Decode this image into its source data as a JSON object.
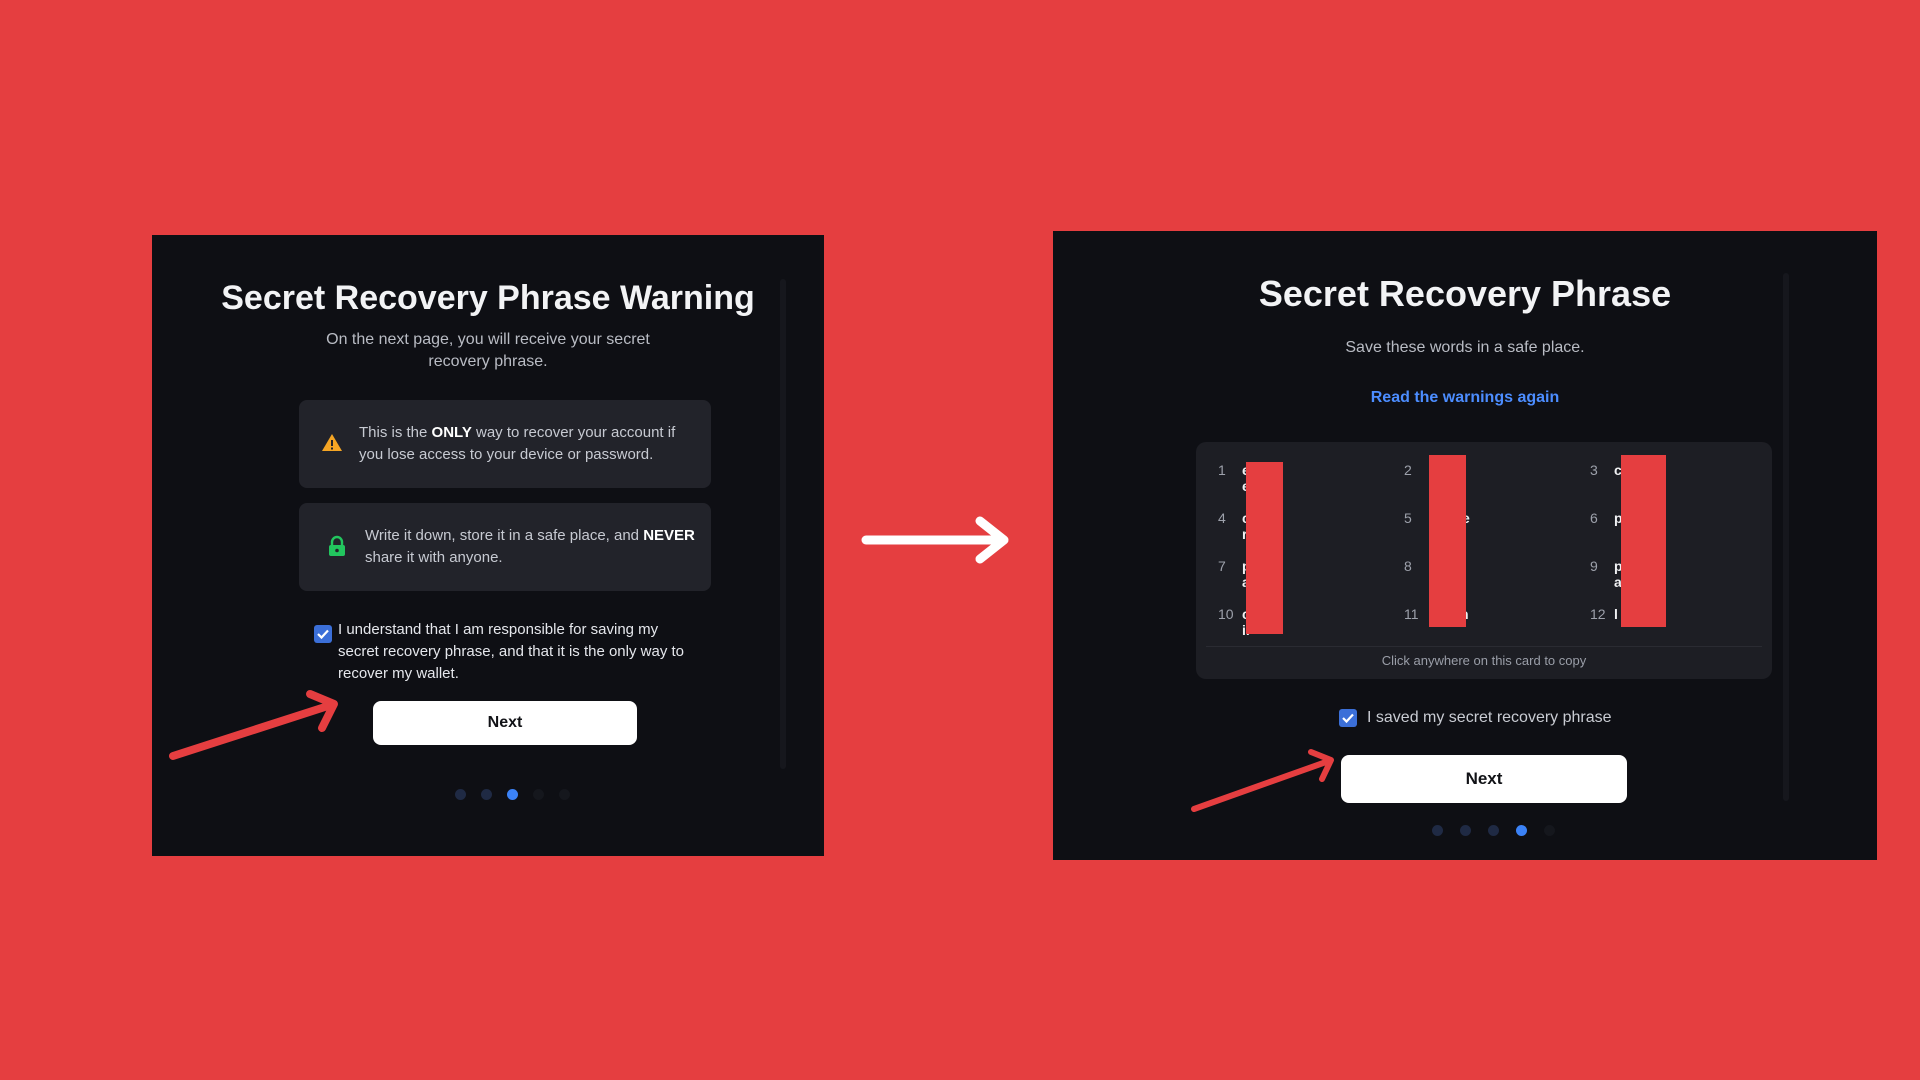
{
  "left": {
    "title": "Secret Recovery Phrase Warning",
    "subtitle": "On the next page, you will receive your secret recovery phrase.",
    "cards": [
      {
        "icon": "warning-triangle-icon",
        "text_before": "This is the ",
        "emphasis": "ONLY",
        "text_after": " way to recover your account if you lose access to your device or password."
      },
      {
        "icon": "lock-icon",
        "text_before": "Write it down, store it in a safe place, and ",
        "emphasis": "NEVER",
        "text_after": " share it with anyone."
      }
    ],
    "checkbox_label": "I understand that I am responsible for saving my secret recovery phrase, and that it is the only way to recover my wallet.",
    "checkbox_checked": true,
    "next_label": "Next",
    "steps_total": 5,
    "step_active": 3
  },
  "right": {
    "title": "Secret Recovery Phrase",
    "subtitle": "Save these words in a safe place.",
    "read_warnings_link": "Read the warnings again",
    "words": [
      {
        "n": "1",
        "visible": "e        e"
      },
      {
        "n": "2",
        "visible": ""
      },
      {
        "n": "3",
        "visible": "c"
      },
      {
        "n": "4",
        "visible": "c       r"
      },
      {
        "n": "5",
        "visible": "e"
      },
      {
        "n": "6",
        "visible": "p"
      },
      {
        "n": "7",
        "visible": "p       ar"
      },
      {
        "n": "8",
        "visible": ""
      },
      {
        "n": "9",
        "visible": "p       al"
      },
      {
        "n": "10",
        "visible": "c       ir"
      },
      {
        "n": "11",
        "visible": "n"
      },
      {
        "n": "12",
        "visible": "l"
      }
    ],
    "copy_hint": "Click anywhere on this card to copy",
    "checkbox_label": "I saved my secret recovery phrase",
    "checkbox_checked": true,
    "next_label": "Next",
    "steps_total": 5,
    "step_active": 4
  },
  "colors": {
    "background": "#e53e40",
    "panel": "#0e0f14",
    "card": "#22232a",
    "accent": "#3b82f6",
    "link": "#4c8dff",
    "warning": "#f5a524",
    "lock": "#22c55e",
    "annotation_arrow": "#e53e40"
  }
}
